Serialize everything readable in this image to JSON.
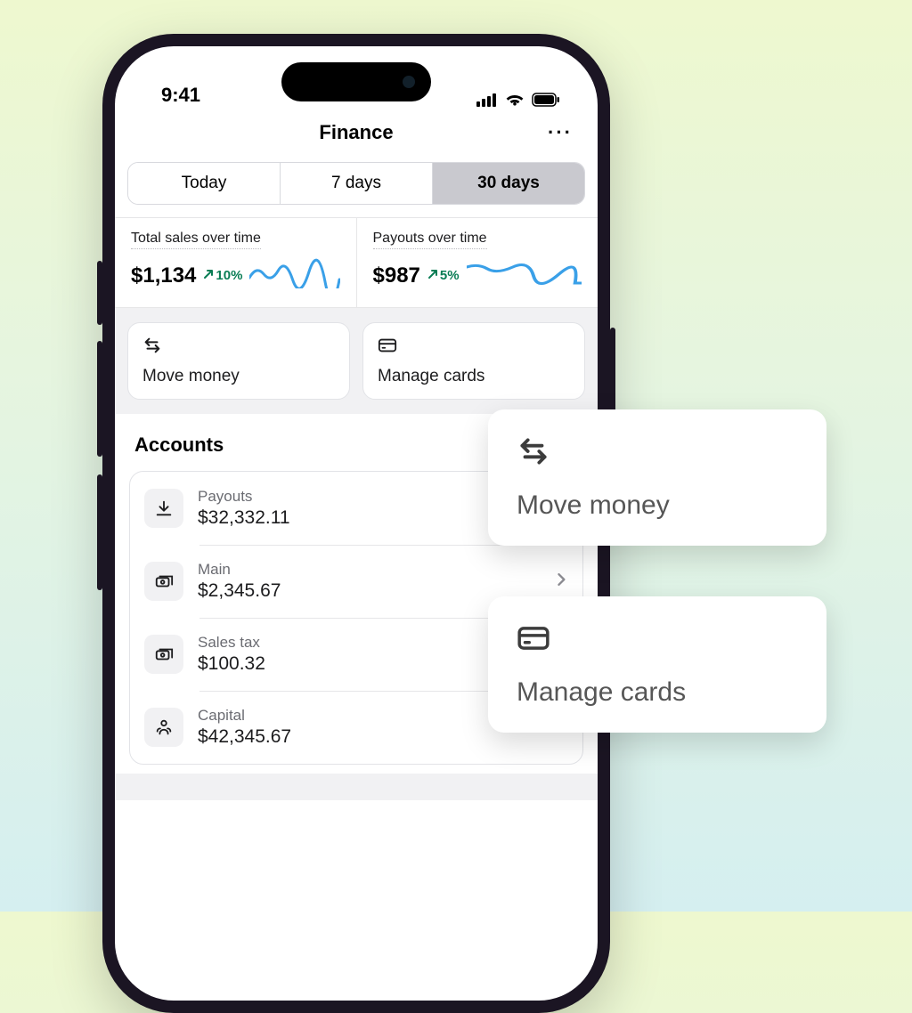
{
  "status": {
    "time": "9:41"
  },
  "header": {
    "title": "Finance",
    "more_label": "···"
  },
  "segmented": {
    "items": [
      "Today",
      "7 days",
      "30 days"
    ],
    "active_index": 2
  },
  "metrics": [
    {
      "title": "Total sales over time",
      "value": "$1,134",
      "delta": "10%"
    },
    {
      "title": "Payouts over time",
      "value": "$987",
      "delta": "5%"
    }
  ],
  "actions": {
    "move_money": "Move money",
    "manage_cards": "Manage cards"
  },
  "accounts": {
    "section_title": "Accounts",
    "items": [
      {
        "name": "Payouts",
        "amount": "$32,332.11",
        "icon": "download",
        "caret": false
      },
      {
        "name": "Main",
        "amount": "$2,345.67",
        "icon": "stack",
        "caret": true
      },
      {
        "name": "Sales tax",
        "amount": "$100.32",
        "icon": "stack",
        "caret": false
      },
      {
        "name": "Capital",
        "amount": "$42,345.67",
        "icon": "capital",
        "caret": true
      }
    ]
  },
  "callouts": {
    "move_money": "Move money",
    "manage_cards": "Manage cards"
  }
}
